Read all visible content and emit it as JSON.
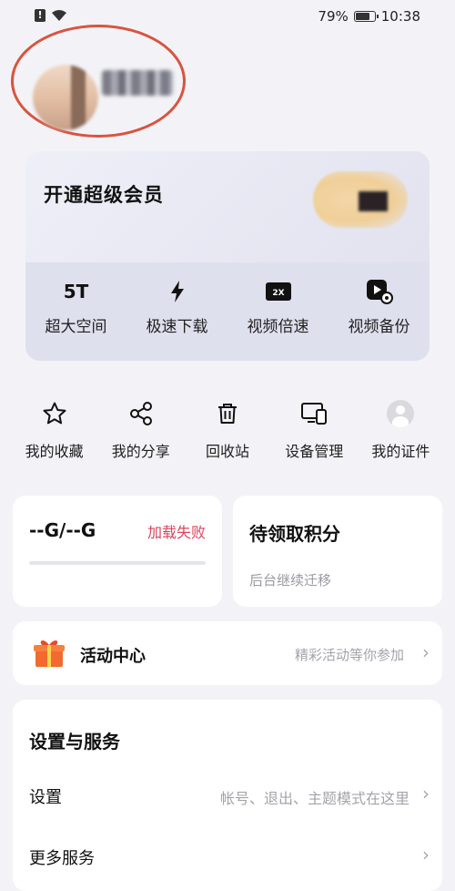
{
  "status_bar": {
    "alert_glyph": "!",
    "battery_percent": "79%",
    "battery_level": 0.79,
    "time": "10:38"
  },
  "profile": {
    "avatar_icon": "avatar-blurred",
    "username_icon": "username-blurred",
    "highlight_color": "#d9543f"
  },
  "vip": {
    "title": "开通超级会员",
    "badge_color": "#f0cf98",
    "features": [
      {
        "icon": "5T",
        "label": "超大空间"
      },
      {
        "icon": "lightning-icon",
        "label": "极速下载"
      },
      {
        "icon": "speed-2x-icon",
        "label": "视频倍速"
      },
      {
        "icon": "video-backup-icon",
        "label": "视频备份"
      }
    ]
  },
  "quick_actions": [
    {
      "icon": "star-icon",
      "label": "我的收藏"
    },
    {
      "icon": "share-icon",
      "label": "我的分享"
    },
    {
      "icon": "trash-icon",
      "label": "回收站"
    },
    {
      "icon": "devices-icon",
      "label": "设备管理"
    },
    {
      "icon": "person-icon",
      "label": "我的证件"
    }
  ],
  "storage": {
    "value": "--G/--G",
    "status": "加载失败",
    "status_color": "#d9455c",
    "used_fraction": 0
  },
  "points": {
    "title": "待领取积分",
    "subtitle": "后台继续迁移"
  },
  "activity": {
    "title": "活动中心",
    "subtitle": "精彩活动等你参加",
    "chevron": "›"
  },
  "settings": {
    "title": "设置与服务",
    "rows": [
      {
        "label": "设置",
        "desc": "帐号、退出、主题模式在这里",
        "chevron": "›"
      },
      {
        "label": "更多服务",
        "desc": "",
        "chevron": "›"
      }
    ]
  }
}
